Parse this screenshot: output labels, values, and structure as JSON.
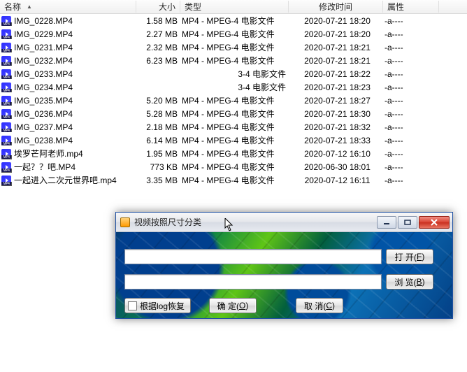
{
  "headers": {
    "name": "名称",
    "size": "大小",
    "type": "类型",
    "mtime": "修改时间",
    "attr": "属性"
  },
  "files": [
    {
      "name": "IMG_0228.MP4",
      "size": "1.58 MB",
      "type": "MP4 - MPEG-4 电影文件",
      "mtime": "2020-07-21  18:20",
      "attr": "-a----"
    },
    {
      "name": "IMG_0229.MP4",
      "size": "2.27 MB",
      "type": "MP4 - MPEG-4 电影文件",
      "mtime": "2020-07-21  18:20",
      "attr": "-a----"
    },
    {
      "name": "IMG_0231.MP4",
      "size": "2.32 MB",
      "type": "MP4 - MPEG-4 电影文件",
      "mtime": "2020-07-21  18:21",
      "attr": "-a----"
    },
    {
      "name": "IMG_0232.MP4",
      "size": "6.23 MB",
      "type": "MP4 - MPEG-4 电影文件",
      "mtime": "2020-07-21  18:21",
      "attr": "-a----"
    },
    {
      "name": "IMG_0233.MP4",
      "size": "",
      "type": "3-4 电影文件",
      "mtime": "2020-07-21  18:22",
      "attr": "-a----"
    },
    {
      "name": "IMG_0234.MP4",
      "size": "",
      "type": "3-4 电影文件",
      "mtime": "2020-07-21  18:23",
      "attr": "-a----"
    },
    {
      "name": "IMG_0235.MP4",
      "size": "5.20 MB",
      "type": "MP4 - MPEG-4 电影文件",
      "mtime": "2020-07-21  18:27",
      "attr": "-a----"
    },
    {
      "name": "IMG_0236.MP4",
      "size": "5.28 MB",
      "type": "MP4 - MPEG-4 电影文件",
      "mtime": "2020-07-21  18:30",
      "attr": "-a----"
    },
    {
      "name": "IMG_0237.MP4",
      "size": "2.18 MB",
      "type": "MP4 - MPEG-4 电影文件",
      "mtime": "2020-07-21  18:32",
      "attr": "-a----"
    },
    {
      "name": "IMG_0238.MP4",
      "size": "6.14 MB",
      "type": "MP4 - MPEG-4 电影文件",
      "mtime": "2020-07-21  18:33",
      "attr": "-a----"
    },
    {
      "name": "埃罗芒阿老师.mp4",
      "size": "1.95 MB",
      "type": "MP4 - MPEG-4 电影文件",
      "mtime": "2020-07-12  16:10",
      "attr": "-a----"
    },
    {
      "name": "一起？？吧.MP4",
      "size": "773 KB",
      "type": "MP4 - MPEG-4 电影文件",
      "mtime": "2020-06-30  18:01",
      "attr": "-a----"
    },
    {
      "name": "一起进入二次元世界吧.mp4",
      "size": "3.35 MB",
      "type": "MP4 - MPEG-4 电影文件",
      "mtime": "2020-07-12  16:11",
      "attr": "-a----"
    }
  ],
  "dialog": {
    "title": "视频按照尺寸分类",
    "input1": "",
    "input2": "",
    "open_label_pre": "打 开(",
    "open_mn": "F",
    "open_label_post": ")",
    "browse_label_pre": "浏 览(",
    "browse_mn": "B",
    "browse_label_post": ")",
    "ok_label_pre": "确 定(",
    "ok_mn": "O",
    "ok_label_post": ")",
    "cancel_label_pre": "取 消(",
    "cancel_mn": "C",
    "cancel_label_post": ")",
    "restore_label": "根据log恢复"
  }
}
